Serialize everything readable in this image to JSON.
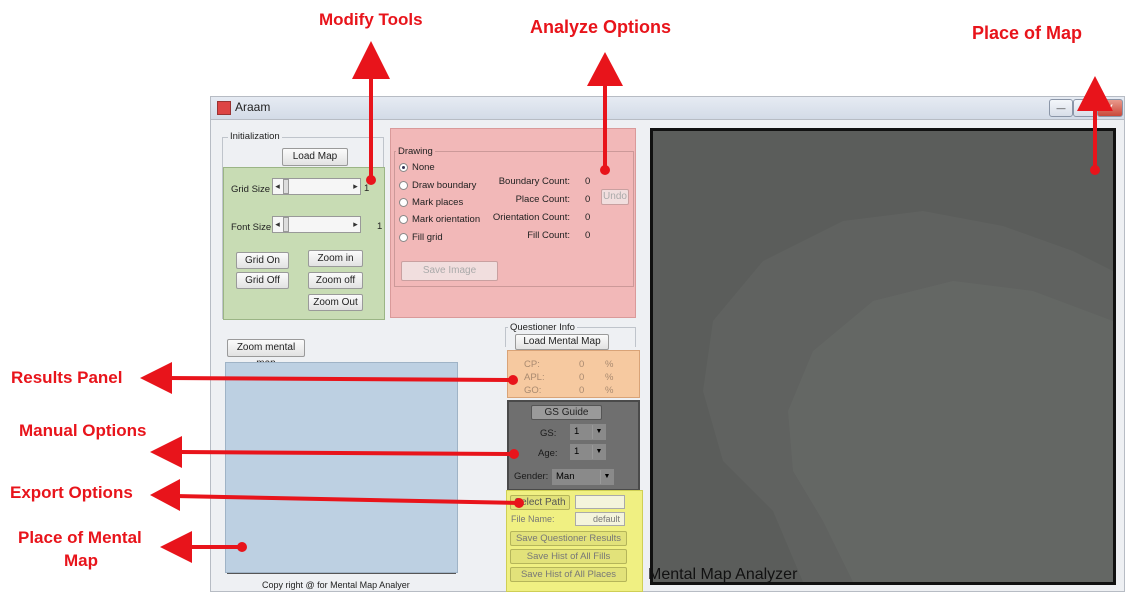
{
  "annotations": {
    "modify_tools": "Modify Tools",
    "analyze_options": "Analyze Options",
    "place_of_map": "Place of Map",
    "results_panel": "Results Panel",
    "manual_options": "Manual Options",
    "export_options": "Export Options",
    "place_of_mental_map_1": "Place of Mental",
    "place_of_mental_map_2": "Map",
    "arrow_color": "#e8141b"
  },
  "window": {
    "title": "Araam",
    "minimize": "—",
    "maximize": "□",
    "close": "X"
  },
  "initialization": {
    "title": "Initialization",
    "load_map": "Load Map",
    "grid_size_label": "Grid Size",
    "grid_size_value": "1",
    "font_size_label": "Font Size",
    "font_size_value": "1",
    "grid_on": "Grid On",
    "grid_off": "Grid Off",
    "zoom_in": "Zoom in",
    "zoom_off": "Zoom off",
    "zoom_out": "Zoom Out"
  },
  "drawing": {
    "title": "Drawing",
    "options": [
      "None",
      "Draw boundary",
      "Mark places",
      "Mark orientation",
      "Fill grid"
    ],
    "selected": "None",
    "counts": [
      {
        "label": "Boundary Count:",
        "value": "0"
      },
      {
        "label": "Place Count:",
        "value": "0"
      },
      {
        "label": "Orientation Count:",
        "value": "0"
      },
      {
        "label": "Fill Count:",
        "value": "0"
      }
    ],
    "undo": "Undo",
    "save_image": "Save Image"
  },
  "mental_map": {
    "zoom_button": "Zoom mental map",
    "copyright": "Copy right @ for Mental Map Analyer"
  },
  "questioner": {
    "title": "Questioner Info",
    "load_button": "Load Mental Map",
    "results": [
      {
        "label": "CP:",
        "value": "0",
        "unit": "%"
      },
      {
        "label": "APL:",
        "value": "0",
        "unit": "%"
      },
      {
        "label": "GO:",
        "value": "0",
        "unit": "%"
      }
    ]
  },
  "manual": {
    "gs_guide": "GS Guide",
    "gs_label": "GS:",
    "gs_value": "1",
    "age_label": "Age:",
    "age_value": "1",
    "gender_label": "Gender:",
    "gender_value": "Man"
  },
  "export": {
    "select_path": "Select Path",
    "file_name_label": "File Name:",
    "file_name_value": "default",
    "save_results": "Save Questioner Results",
    "save_fills": "Save Hist of All Fills",
    "save_places": "Save Hist of All Places"
  },
  "map": {
    "watermark": "Mental Map Analyzer"
  },
  "colors": {
    "modify_highlight": "#c8dcb4",
    "analyze_highlight": "#f2b8b8",
    "results_highlight": "#f6c9a0",
    "manual_highlight": "#6f6f6f",
    "export_highlight": "#f0f082",
    "mental_map_panel": "#bdd0e2",
    "map_panel": "#5b5d5b"
  }
}
